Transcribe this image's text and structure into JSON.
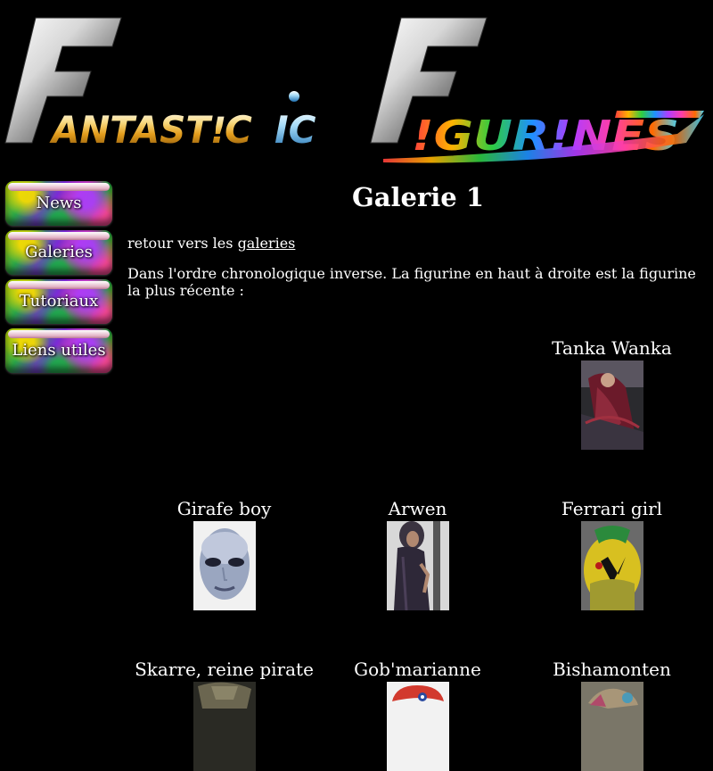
{
  "site": {
    "logo_text": "FANTASTIC F!GUR!NES"
  },
  "nav": {
    "items": [
      {
        "label": "News"
      },
      {
        "label": "Galeries"
      },
      {
        "label": "Tutoriaux"
      },
      {
        "label": "Liens utiles"
      }
    ]
  },
  "page": {
    "title": "Galerie 1",
    "back_prefix": "retour vers les ",
    "back_link": "galeries",
    "intro": "Dans l'ordre chronologique inverse. La figurine en haut à droite est la figurine la plus récente :"
  },
  "gallery": {
    "rows": [
      [
        {
          "name": ""
        },
        {
          "name": ""
        },
        {
          "name": "Tanka Wanka",
          "image": "figurine-photo-tanka-wanka"
        }
      ],
      [
        {
          "name": "Girafe boy",
          "image": "figurine-photo-girafe-boy"
        },
        {
          "name": "Arwen",
          "image": "figurine-photo-arwen"
        },
        {
          "name": "Ferrari girl",
          "image": "figurine-photo-ferrari-girl"
        }
      ],
      [
        {
          "name": "Skarre, reine pirate",
          "image": "figurine-photo-skarre"
        },
        {
          "name": "Gob'marianne",
          "image": "figurine-photo-gob-marianne"
        },
        {
          "name": "Bishamonten",
          "image": "figurine-photo-bishamonten"
        }
      ]
    ]
  }
}
